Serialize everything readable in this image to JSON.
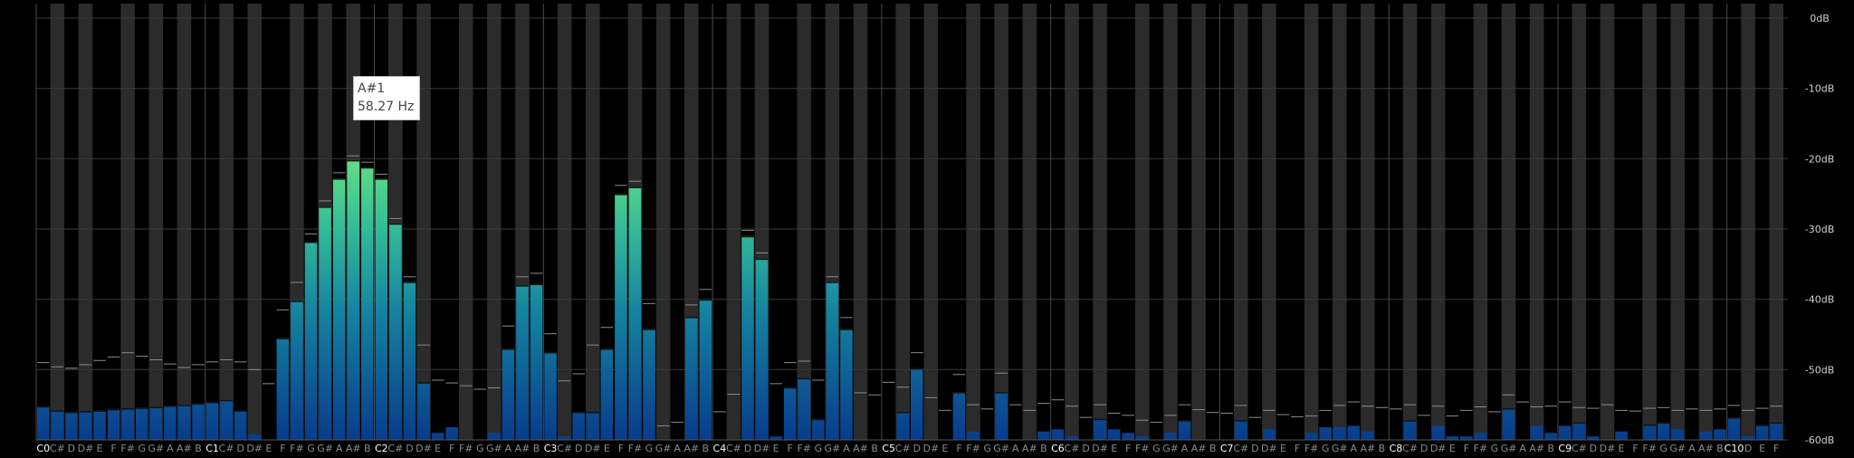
{
  "tooltip": {
    "note": "A#1",
    "freq": "58.27 Hz"
  },
  "chart_data": {
    "type": "bar",
    "ylim": [
      -60,
      0
    ],
    "yticks": [
      "0dB",
      "-10dB",
      "-20dB",
      "-30dB",
      "-40dB",
      "-50dB",
      "-60dB"
    ],
    "categories": [
      "C0",
      "C#",
      "D",
      "D#",
      "E",
      "F",
      "F#",
      "G",
      "G#",
      "A",
      "A#",
      "B",
      "C1",
      "C#",
      "D",
      "D#",
      "E",
      "F",
      "F#",
      "G",
      "G#",
      "A",
      "A#",
      "B",
      "C2",
      "C#",
      "D",
      "D#",
      "E",
      "F",
      "F#",
      "G",
      "G#",
      "A",
      "A#",
      "B",
      "C3",
      "C#",
      "D",
      "D#",
      "E",
      "F",
      "F#",
      "G",
      "G#",
      "A",
      "A#",
      "B",
      "C4",
      "C#",
      "D",
      "D#",
      "E",
      "F",
      "F#",
      "G",
      "G#",
      "A",
      "A#",
      "B",
      "C5",
      "C#",
      "D",
      "D#",
      "E",
      "F",
      "F#",
      "G",
      "G#",
      "A",
      "A#",
      "B",
      "C6",
      "C#",
      "D",
      "D#",
      "E",
      "F",
      "F#",
      "G",
      "G#",
      "A",
      "A#",
      "B",
      "C7",
      "C#",
      "D",
      "D#",
      "E",
      "F",
      "F#",
      "G",
      "G#",
      "A",
      "A#",
      "B",
      "C8",
      "C#",
      "D",
      "D#",
      "E",
      "F",
      "F#",
      "G",
      "G#",
      "A",
      "A#",
      "B",
      "C9",
      "C#",
      "D",
      "D#",
      "E",
      "F",
      "F#",
      "G",
      "G#",
      "A",
      "A#",
      "B",
      "C10",
      "D",
      "E",
      "F"
    ],
    "values": [
      -55.2,
      -55.8,
      -56.0,
      -55.9,
      -55.8,
      -55.6,
      -55.5,
      -55.4,
      -55.3,
      -55.1,
      -55.0,
      -54.8,
      -54.6,
      -54.3,
      -55.8,
      -59.2,
      -60,
      -45.5,
      -40.2,
      -31.8,
      -26.8,
      -22.8,
      -20.2,
      -21.2,
      -22.8,
      -29.2,
      -37.5,
      -51.8,
      -59.0,
      -58.2,
      -60,
      -60,
      -59.0,
      -47.0,
      -38.0,
      -37.8,
      -47.5,
      -59.5,
      -56.0,
      -56.0,
      -47.0,
      -25.0,
      -24.0,
      -44.2,
      -60,
      -60,
      -42.5,
      -40.0,
      -60,
      -60,
      -31.0,
      -34.2,
      -59.5,
      -52.5,
      -51.2,
      -57.0,
      -37.5,
      -44.2,
      -60,
      -60,
      -60,
      -56.0,
      -49.8,
      -60,
      -60,
      -53.2,
      -58.8,
      -60,
      -53.2,
      -60,
      -60,
      -58.8,
      -58.5,
      -59.5,
      -60,
      -57.0,
      -58.5,
      -59.0,
      -59.5,
      -60,
      -59.0,
      -57.2,
      -60,
      -60,
      -60,
      -57.2,
      -60,
      -58.5,
      -60,
      -60,
      -59.0,
      -58.2,
      -58.2,
      -58.0,
      -58.8,
      -60,
      -60,
      -57.2,
      -60,
      -58.0,
      -59.5,
      -59.5,
      -59.0,
      -60,
      -55.5,
      -60,
      -58.0,
      -59.0,
      -58.0,
      -57.5,
      -59.5,
      -60,
      -58.8,
      -60,
      -57.8,
      -57.5,
      -58.5,
      -60,
      -58.8,
      -58.5,
      -56.8,
      -59.5,
      -58.0,
      -57.5
    ],
    "peaks": [
      -49.0,
      -49.6,
      -49.8,
      -49.3,
      -48.7,
      -48.2,
      -47.6,
      -48.1,
      -48.6,
      -49.2,
      -49.7,
      -49.3,
      -48.9,
      -48.6,
      -48.9,
      -50.0,
      -52.0,
      -41.5,
      -37.6,
      -30.7,
      -26.0,
      -22.0,
      -19.6,
      -20.5,
      -22.2,
      -28.5,
      -36.8,
      -46.5,
      -51.5,
      -51.9,
      -52.3,
      -52.8,
      -52.6,
      -43.8,
      -36.8,
      -36.3,
      -44.9,
      -51.6,
      -50.6,
      -46.5,
      -44.0,
      -23.8,
      -23.2,
      -40.6,
      -58.0,
      -57.5,
      -40.8,
      -38.6,
      -56.0,
      -53.5,
      -30.2,
      -33.4,
      -52.0,
      -49.0,
      -48.8,
      -51.5,
      -36.8,
      -42.6,
      -53.3,
      -53.6,
      -51.8,
      -52.5,
      -47.6,
      -54.0,
      -55.8,
      -50.7,
      -55.0,
      -55.6,
      -50.5,
      -55.0,
      -55.8,
      -54.8,
      -54.3,
      -55.2,
      -56.8,
      -55.0,
      -56.2,
      -56.5,
      -57.2,
      -57.5,
      -56.5,
      -55.0,
      -55.7,
      -56.1,
      -56.2,
      -55.1,
      -56.8,
      -55.8,
      -56.4,
      -56.7,
      -56.6,
      -55.8,
      -55.1,
      -54.6,
      -55.2,
      -55.4,
      -55.6,
      -55.0,
      -56.5,
      -55.2,
      -56.6,
      -55.8,
      -55.3,
      -56.0,
      -53.6,
      -54.6,
      -55.3,
      -55.2,
      -54.6,
      -55.4,
      -55.5,
      -55.0,
      -55.8,
      -55.9,
      -55.5,
      -55.4,
      -55.8,
      -55.6,
      -55.8,
      -55.6,
      -55.1,
      -55.8,
      -55.5,
      -55.2
    ]
  }
}
